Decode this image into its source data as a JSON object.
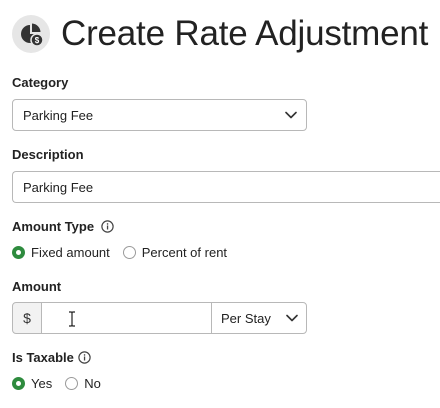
{
  "header": {
    "title": "Create Rate Adjustment",
    "icon": "pie-chart-dollar-icon"
  },
  "category": {
    "label": "Category",
    "selected": "Parking Fee"
  },
  "description": {
    "label": "Description",
    "value": "Parking Fee"
  },
  "amount_type": {
    "label": "Amount Type",
    "options": [
      {
        "label": "Fixed amount",
        "checked": true
      },
      {
        "label": "Percent of rent",
        "checked": false
      }
    ]
  },
  "amount": {
    "label": "Amount",
    "prefix": "$",
    "value": "",
    "frequency": "Per Stay"
  },
  "is_taxable": {
    "label": "Is Taxable",
    "options": [
      {
        "label": "Yes",
        "checked": true
      },
      {
        "label": "No",
        "checked": false
      }
    ]
  },
  "colors": {
    "accent_green": "#2e8b3e",
    "border": "#b8b8b8"
  }
}
